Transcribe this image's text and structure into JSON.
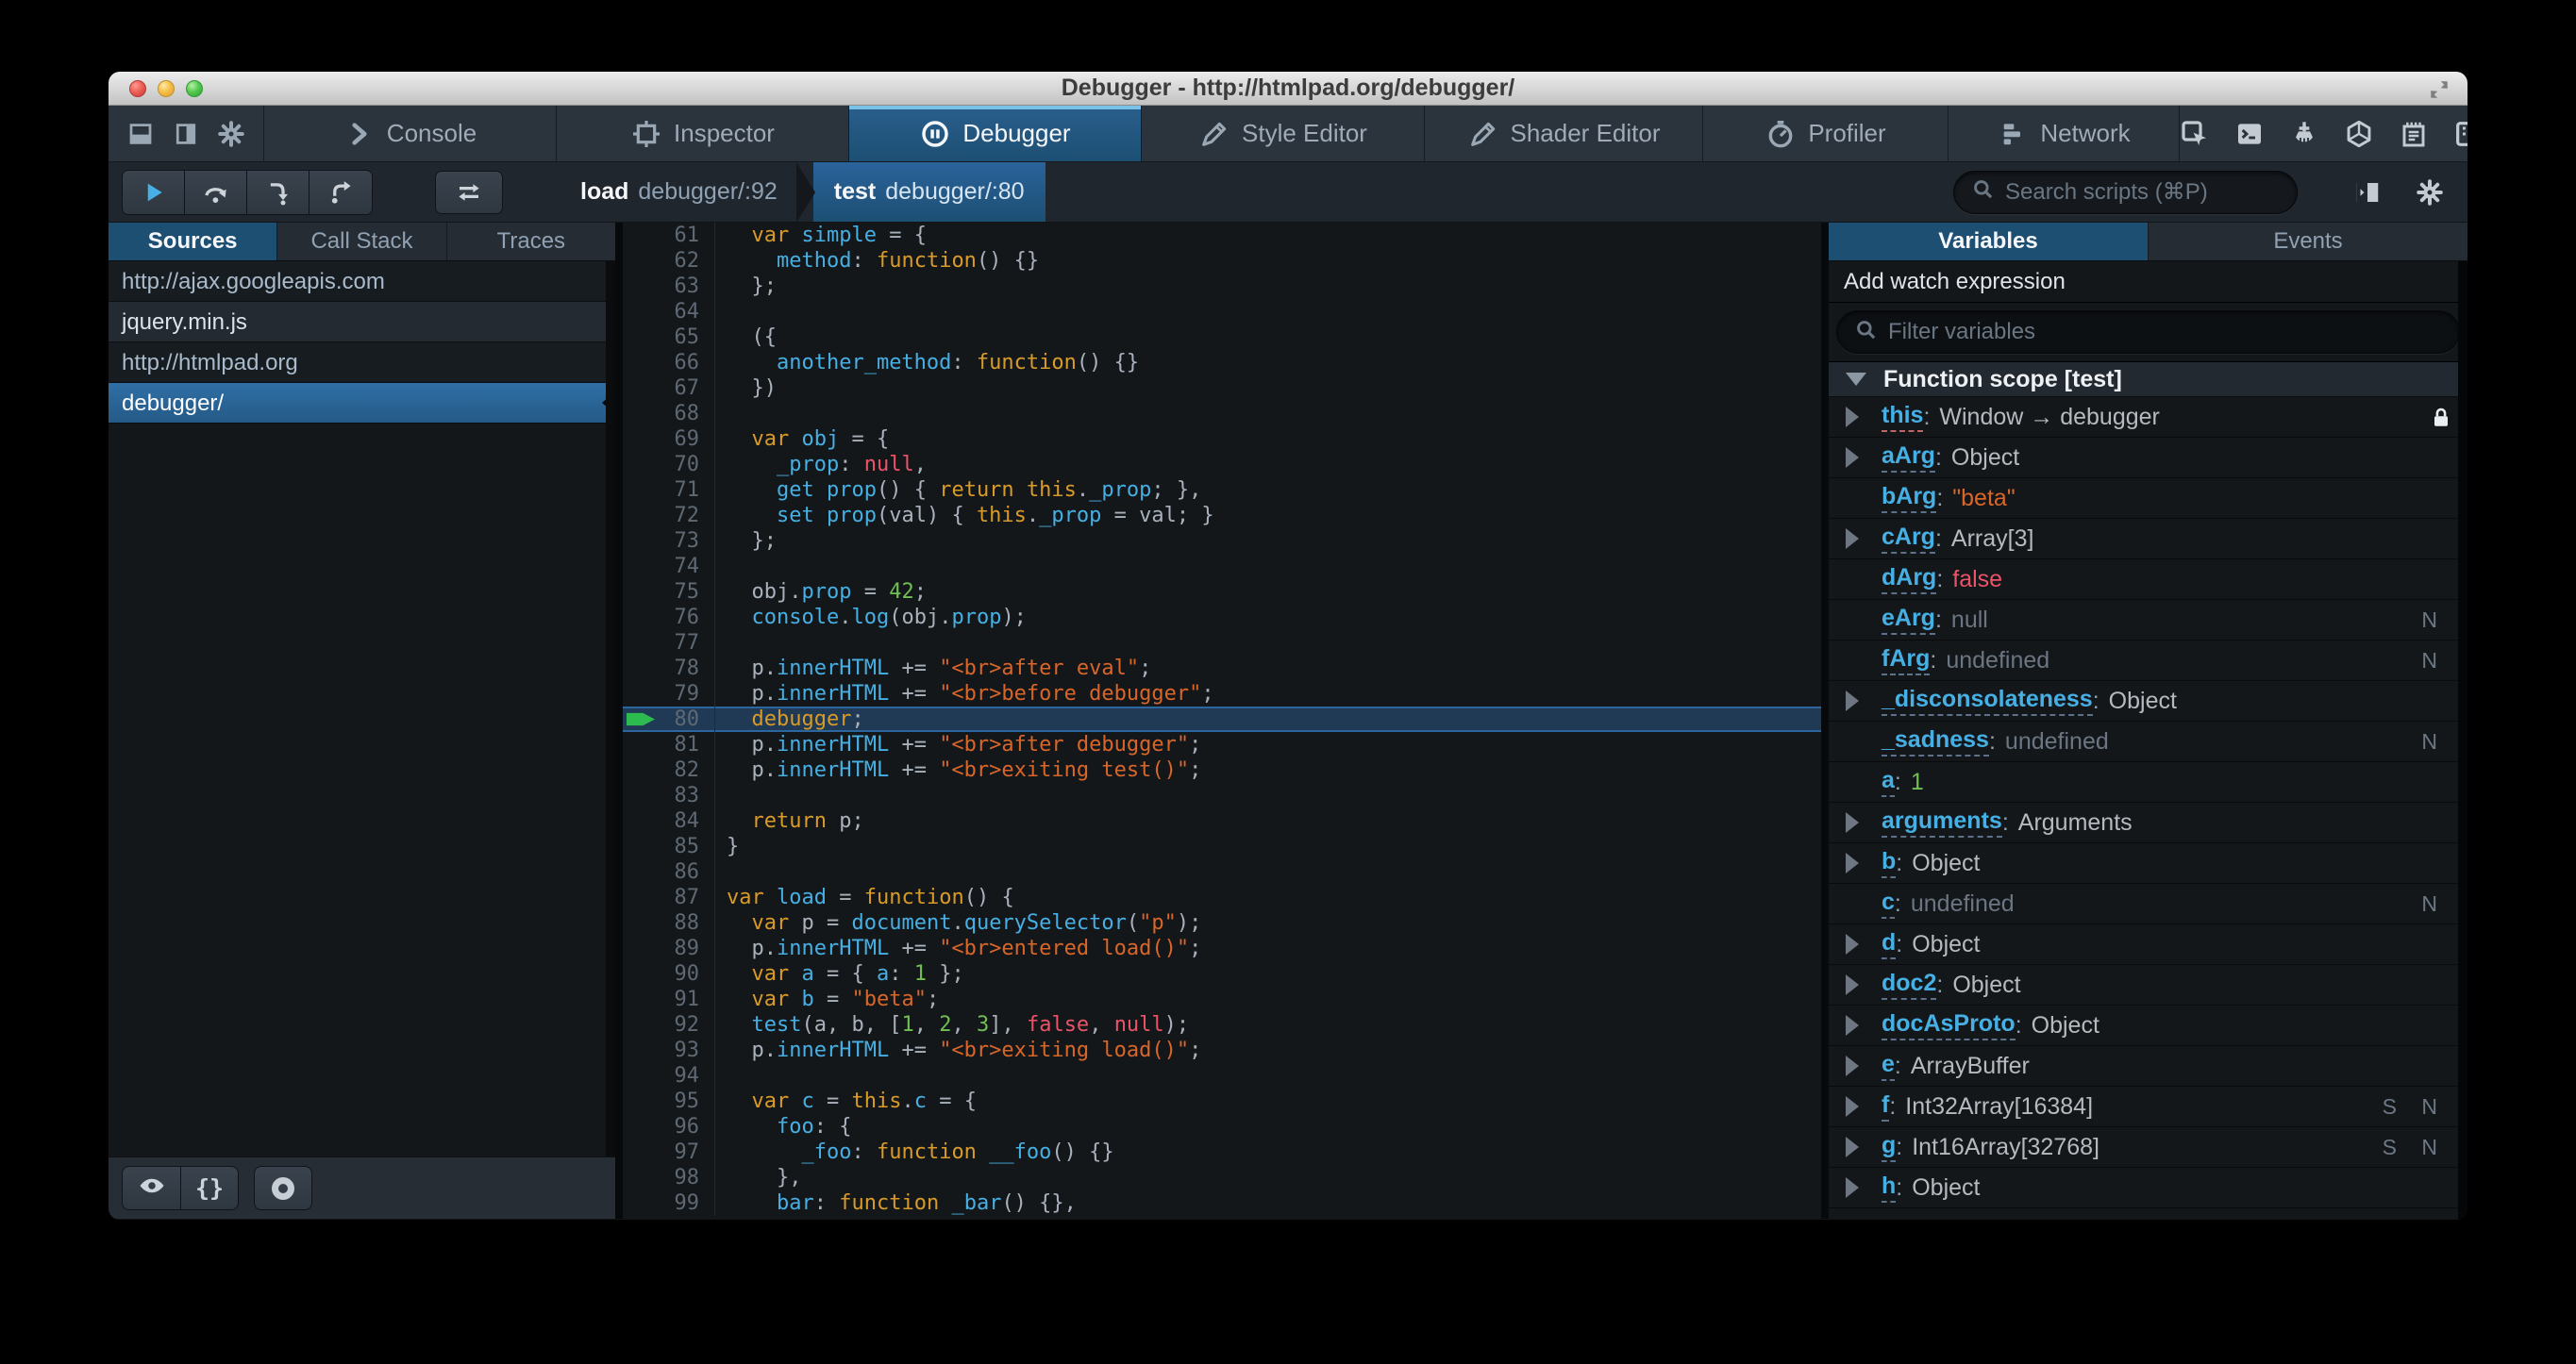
{
  "window": {
    "title": "Debugger - http://htmlpad.org/debugger/"
  },
  "toolbar": {
    "left_icons": [
      "dock-bottom",
      "dock-side",
      "settings"
    ],
    "tabs": [
      {
        "label": "Console",
        "icon": "console"
      },
      {
        "label": "Inspector",
        "icon": "inspector"
      },
      {
        "label": "Debugger",
        "icon": "debugger"
      },
      {
        "label": "Style Editor",
        "icon": "style-editor"
      },
      {
        "label": "Shader Editor",
        "icon": "shader-editor"
      },
      {
        "label": "Profiler",
        "icon": "profiler"
      },
      {
        "label": "Network",
        "icon": "network"
      }
    ],
    "active_tab": "Debugger",
    "right_icons": [
      "pick-element",
      "split-console",
      "paintbrush",
      "tilt-3d",
      "scratchpad",
      "responsive-mode"
    ]
  },
  "controls": {
    "buttons": [
      {
        "name": "resume-button",
        "icon": "resume"
      },
      {
        "name": "step-over-button",
        "icon": "step-over"
      },
      {
        "name": "step-in-button",
        "icon": "step-in"
      },
      {
        "name": "step-out-button",
        "icon": "step-out"
      }
    ],
    "tracer_button": {
      "name": "tracer-toggle-button",
      "icon": "swap"
    },
    "breadcrumbs": [
      {
        "fn": "load",
        "loc": "debugger/:92",
        "active": false
      },
      {
        "fn": "test",
        "loc": "debugger/:80",
        "active": true
      }
    ],
    "search_placeholder": "Search scripts (⌘P)",
    "right_icons": [
      "panel-toggle",
      "settings"
    ]
  },
  "sources": {
    "tabs": [
      {
        "label": "Sources",
        "active": true
      },
      {
        "label": "Call Stack",
        "active": false
      },
      {
        "label": "Traces",
        "active": false
      }
    ],
    "items": [
      {
        "label": "http://ajax.googleapis.com",
        "kind": "group",
        "selected": false
      },
      {
        "label": "jquery.min.js",
        "kind": "file",
        "selected": false
      },
      {
        "label": "http://htmlpad.org",
        "kind": "group",
        "selected": false
      },
      {
        "label": "debugger/",
        "kind": "file",
        "selected": true
      }
    ],
    "footer_buttons": [
      {
        "name": "blackbox-source-button",
        "icon": "eye"
      },
      {
        "name": "pretty-print-button",
        "glyph": "{}"
      },
      {
        "name": "toggle-pause-on-exceptions-button",
        "icon": "ring"
      }
    ]
  },
  "editor": {
    "current_line": 80,
    "lines": [
      {
        "n": 61,
        "t": [
          [
            "pl",
            "  "
          ],
          [
            "kw",
            "var"
          ],
          [
            "pl",
            " "
          ],
          [
            "id",
            "simple"
          ],
          [
            "pl",
            " = {"
          ]
        ]
      },
      {
        "n": 62,
        "t": [
          [
            "pl",
            "    "
          ],
          [
            "id",
            "method"
          ],
          [
            "pl",
            ": "
          ],
          [
            "kw",
            "function"
          ],
          [
            "pl",
            "() {}"
          ]
        ]
      },
      {
        "n": 63,
        "t": [
          [
            "pl",
            "  };"
          ]
        ]
      },
      {
        "n": 64,
        "t": []
      },
      {
        "n": 65,
        "t": [
          [
            "pl",
            "  ({"
          ]
        ]
      },
      {
        "n": 66,
        "t": [
          [
            "pl",
            "    "
          ],
          [
            "id",
            "another_method"
          ],
          [
            "pl",
            ": "
          ],
          [
            "kw",
            "function"
          ],
          [
            "pl",
            "() {}"
          ]
        ]
      },
      {
        "n": 67,
        "t": [
          [
            "pl",
            "  })"
          ]
        ]
      },
      {
        "n": 68,
        "t": []
      },
      {
        "n": 69,
        "t": [
          [
            "pl",
            "  "
          ],
          [
            "kw",
            "var"
          ],
          [
            "pl",
            " "
          ],
          [
            "id",
            "obj"
          ],
          [
            "pl",
            " = {"
          ]
        ]
      },
      {
        "n": 70,
        "t": [
          [
            "pl",
            "    "
          ],
          [
            "id",
            "_prop"
          ],
          [
            "pl",
            ": "
          ],
          [
            "atom",
            "null"
          ],
          [
            "pl",
            ","
          ]
        ]
      },
      {
        "n": 71,
        "t": [
          [
            "pl",
            "    "
          ],
          [
            "id",
            "get"
          ],
          [
            "pl",
            " "
          ],
          [
            "id",
            "prop"
          ],
          [
            "pl",
            "() { "
          ],
          [
            "kw",
            "return"
          ],
          [
            "pl",
            " "
          ],
          [
            "kw",
            "this"
          ],
          [
            "pl",
            "."
          ],
          [
            "id",
            "_prop"
          ],
          [
            "pl",
            "; },"
          ]
        ]
      },
      {
        "n": 72,
        "t": [
          [
            "pl",
            "    "
          ],
          [
            "id",
            "set"
          ],
          [
            "pl",
            " "
          ],
          [
            "id",
            "prop"
          ],
          [
            "pl",
            "(val) { "
          ],
          [
            "kw",
            "this"
          ],
          [
            "pl",
            "."
          ],
          [
            "id",
            "_prop"
          ],
          [
            "pl",
            " = val; }"
          ]
        ]
      },
      {
        "n": 73,
        "t": [
          [
            "pl",
            "  };"
          ]
        ]
      },
      {
        "n": 74,
        "t": []
      },
      {
        "n": 75,
        "t": [
          [
            "pl",
            "  obj."
          ],
          [
            "id",
            "prop"
          ],
          [
            "pl",
            " = "
          ],
          [
            "num",
            "42"
          ],
          [
            "pl",
            ";"
          ]
        ]
      },
      {
        "n": 76,
        "t": [
          [
            "pl",
            "  "
          ],
          [
            "id",
            "console"
          ],
          [
            "pl",
            "."
          ],
          [
            "id",
            "log"
          ],
          [
            "pl",
            "(obj."
          ],
          [
            "id",
            "prop"
          ],
          [
            "pl",
            ");"
          ]
        ]
      },
      {
        "n": 77,
        "t": []
      },
      {
        "n": 78,
        "t": [
          [
            "pl",
            "  p."
          ],
          [
            "id",
            "innerHTML"
          ],
          [
            "pl",
            " += "
          ],
          [
            "str",
            "\"<br>after eval\""
          ],
          [
            "pl",
            ";"
          ]
        ]
      },
      {
        "n": 79,
        "t": [
          [
            "pl",
            "  p."
          ],
          [
            "id",
            "innerHTML"
          ],
          [
            "pl",
            " += "
          ],
          [
            "str",
            "\"<br>before debugger\""
          ],
          [
            "pl",
            ";"
          ]
        ]
      },
      {
        "n": 80,
        "t": [
          [
            "pl",
            "  "
          ],
          [
            "kw",
            "debugger"
          ],
          [
            "pl",
            ";"
          ]
        ]
      },
      {
        "n": 81,
        "t": [
          [
            "pl",
            "  p."
          ],
          [
            "id",
            "innerHTML"
          ],
          [
            "pl",
            " += "
          ],
          [
            "str",
            "\"<br>after debugger\""
          ],
          [
            "pl",
            ";"
          ]
        ]
      },
      {
        "n": 82,
        "t": [
          [
            "pl",
            "  p."
          ],
          [
            "id",
            "innerHTML"
          ],
          [
            "pl",
            " += "
          ],
          [
            "str",
            "\"<br>exiting test()\""
          ],
          [
            "pl",
            ";"
          ]
        ]
      },
      {
        "n": 83,
        "t": []
      },
      {
        "n": 84,
        "t": [
          [
            "pl",
            "  "
          ],
          [
            "kw",
            "return"
          ],
          [
            "pl",
            " p;"
          ]
        ]
      },
      {
        "n": 85,
        "t": [
          [
            "pl",
            "}"
          ]
        ]
      },
      {
        "n": 86,
        "t": []
      },
      {
        "n": 87,
        "t": [
          [
            "kw",
            "var"
          ],
          [
            "pl",
            " "
          ],
          [
            "id",
            "load"
          ],
          [
            "pl",
            " = "
          ],
          [
            "kw",
            "function"
          ],
          [
            "pl",
            "() {"
          ]
        ]
      },
      {
        "n": 88,
        "t": [
          [
            "pl",
            "  "
          ],
          [
            "kw",
            "var"
          ],
          [
            "pl",
            " p = "
          ],
          [
            "id",
            "document"
          ],
          [
            "pl",
            "."
          ],
          [
            "id",
            "querySelector"
          ],
          [
            "pl",
            "("
          ],
          [
            "str",
            "\"p\""
          ],
          [
            "pl",
            ");"
          ]
        ]
      },
      {
        "n": 89,
        "t": [
          [
            "pl",
            "  p."
          ],
          [
            "id",
            "innerHTML"
          ],
          [
            "pl",
            " += "
          ],
          [
            "str",
            "\"<br>entered load()\""
          ],
          [
            "pl",
            ";"
          ]
        ]
      },
      {
        "n": 90,
        "t": [
          [
            "pl",
            "  "
          ],
          [
            "kw",
            "var"
          ],
          [
            "pl",
            " "
          ],
          [
            "id",
            "a"
          ],
          [
            "pl",
            " = { "
          ],
          [
            "id",
            "a"
          ],
          [
            "pl",
            ": "
          ],
          [
            "num",
            "1"
          ],
          [
            "pl",
            " };"
          ]
        ]
      },
      {
        "n": 91,
        "t": [
          [
            "pl",
            "  "
          ],
          [
            "kw",
            "var"
          ],
          [
            "pl",
            " "
          ],
          [
            "id",
            "b"
          ],
          [
            "pl",
            " = "
          ],
          [
            "str",
            "\"beta\""
          ],
          [
            "pl",
            ";"
          ]
        ]
      },
      {
        "n": 92,
        "t": [
          [
            "pl",
            "  "
          ],
          [
            "id",
            "test"
          ],
          [
            "pl",
            "(a, b, ["
          ],
          [
            "num",
            "1"
          ],
          [
            "pl",
            ", "
          ],
          [
            "num",
            "2"
          ],
          [
            "pl",
            ", "
          ],
          [
            "num",
            "3"
          ],
          [
            "pl",
            "], "
          ],
          [
            "atom",
            "false"
          ],
          [
            "pl",
            ", "
          ],
          [
            "atom",
            "null"
          ],
          [
            "pl",
            ");"
          ]
        ]
      },
      {
        "n": 93,
        "t": [
          [
            "pl",
            "  p."
          ],
          [
            "id",
            "innerHTML"
          ],
          [
            "pl",
            " += "
          ],
          [
            "str",
            "\"<br>exiting load()\""
          ],
          [
            "pl",
            ";"
          ]
        ]
      },
      {
        "n": 94,
        "t": []
      },
      {
        "n": 95,
        "t": [
          [
            "pl",
            "  "
          ],
          [
            "kw",
            "var"
          ],
          [
            "pl",
            " "
          ],
          [
            "id",
            "c"
          ],
          [
            "pl",
            " = "
          ],
          [
            "kw",
            "this"
          ],
          [
            "pl",
            "."
          ],
          [
            "id",
            "c"
          ],
          [
            "pl",
            " = {"
          ]
        ]
      },
      {
        "n": 96,
        "t": [
          [
            "pl",
            "    "
          ],
          [
            "id",
            "foo"
          ],
          [
            "pl",
            ": {"
          ]
        ]
      },
      {
        "n": 97,
        "t": [
          [
            "pl",
            "      "
          ],
          [
            "id",
            "_foo"
          ],
          [
            "pl",
            ": "
          ],
          [
            "kw",
            "function"
          ],
          [
            "pl",
            " "
          ],
          [
            "id",
            "__foo"
          ],
          [
            "pl",
            "() {}"
          ]
        ]
      },
      {
        "n": 98,
        "t": [
          [
            "pl",
            "    },"
          ]
        ]
      },
      {
        "n": 99,
        "t": [
          [
            "pl",
            "    "
          ],
          [
            "id",
            "bar"
          ],
          [
            "pl",
            ": "
          ],
          [
            "kw",
            "function"
          ],
          [
            "pl",
            " "
          ],
          [
            "id",
            "_bar"
          ],
          [
            "pl",
            "() {},"
          ]
        ]
      }
    ]
  },
  "variables": {
    "tabs": [
      {
        "label": "Variables",
        "active": true
      },
      {
        "label": "Events",
        "active": false
      }
    ],
    "watch_label": "Add watch expression",
    "filter_placeholder": "Filter variables",
    "scope_label": "Function scope [test]",
    "items": [
      {
        "name": "this",
        "value": "Window → debugger",
        "vclass": "obj",
        "expandable": true,
        "special": true,
        "lock": true,
        "badges": ""
      },
      {
        "name": "aArg",
        "value": "Object",
        "vclass": "obj",
        "expandable": true,
        "badges": ""
      },
      {
        "name": "bArg",
        "value": "\"beta\"",
        "vclass": "str",
        "expandable": false,
        "badges": ""
      },
      {
        "name": "cArg",
        "value": "Array[3]",
        "vclass": "obj",
        "expandable": true,
        "badges": ""
      },
      {
        "name": "dArg",
        "value": "false",
        "vclass": "bool",
        "expandable": false,
        "badges": ""
      },
      {
        "name": "eArg",
        "value": "null",
        "vclass": "nul",
        "expandable": false,
        "badges": "N"
      },
      {
        "name": "fArg",
        "value": "undefined",
        "vclass": "undef",
        "expandable": false,
        "badges": "N"
      },
      {
        "name": "_disconsolateness",
        "value": "Object",
        "vclass": "obj",
        "expandable": true,
        "badges": ""
      },
      {
        "name": "_sadness",
        "value": "undefined",
        "vclass": "undef",
        "expandable": false,
        "badges": "N"
      },
      {
        "name": "a",
        "value": "1",
        "vclass": "num",
        "expandable": false,
        "badges": ""
      },
      {
        "name": "arguments",
        "value": "Arguments",
        "vclass": "obj",
        "expandable": true,
        "badges": ""
      },
      {
        "name": "b",
        "value": "Object",
        "vclass": "obj",
        "expandable": true,
        "badges": ""
      },
      {
        "name": "c",
        "value": "undefined",
        "vclass": "undef",
        "expandable": false,
        "badges": "N"
      },
      {
        "name": "d",
        "value": "Object",
        "vclass": "obj",
        "expandable": true,
        "badges": ""
      },
      {
        "name": "doc2",
        "value": "Object",
        "vclass": "obj",
        "expandable": true,
        "badges": ""
      },
      {
        "name": "docAsProto",
        "value": "Object",
        "vclass": "obj",
        "expandable": true,
        "badges": ""
      },
      {
        "name": "e",
        "value": "ArrayBuffer",
        "vclass": "obj",
        "expandable": true,
        "badges": ""
      },
      {
        "name": "f",
        "value": "Int32Array[16384]",
        "vclass": "obj",
        "expandable": true,
        "badges": "S N"
      },
      {
        "name": "g",
        "value": "Int16Array[32768]",
        "vclass": "obj",
        "expandable": true,
        "badges": "S N"
      },
      {
        "name": "h",
        "value": "Object",
        "vclass": "obj",
        "expandable": true,
        "badges": ""
      }
    ]
  }
}
